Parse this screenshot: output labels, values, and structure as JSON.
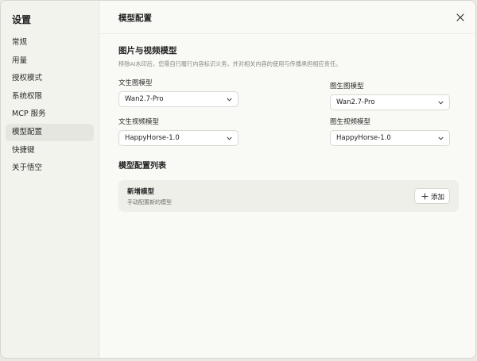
{
  "sidebar": {
    "title": "设置",
    "items": [
      {
        "label": "常规",
        "active": false
      },
      {
        "label": "用量",
        "active": false
      },
      {
        "label": "授权模式",
        "active": false
      },
      {
        "label": "系统权限",
        "active": false
      },
      {
        "label": "MCP 服务",
        "active": false
      },
      {
        "label": "模型配置",
        "active": true
      },
      {
        "label": "快捷键",
        "active": false
      },
      {
        "label": "关于悟空",
        "active": false
      }
    ]
  },
  "header": {
    "title": "模型配置",
    "close_icon": "close-icon"
  },
  "media_section": {
    "title": "图片与视频模型",
    "description": "移除AI水印后，您需自行履行内容标识义务，并对相关内容的使用与传播承担相应责任。",
    "text_to_image": {
      "label": "文生图模型",
      "value": "Wan2.7-Pro"
    },
    "image_to_image": {
      "label": "图生图模型",
      "value": "Wan2.7-Pro"
    },
    "text_to_video": {
      "label": "文生视频模型",
      "value": "HappyHorse-1.0"
    },
    "image_to_video": {
      "label": "图生视频模型",
      "value": "HappyHorse-1.0"
    }
  },
  "model_list": {
    "title": "模型配置列表",
    "card_title": "新增模型",
    "card_description": "手动配置新的模型",
    "add_label": "添加"
  },
  "colors": {
    "background": "#f9f9f5",
    "sidebar": "#f3f3ee",
    "active_item": "#e6e6e0",
    "card": "#efefea"
  }
}
